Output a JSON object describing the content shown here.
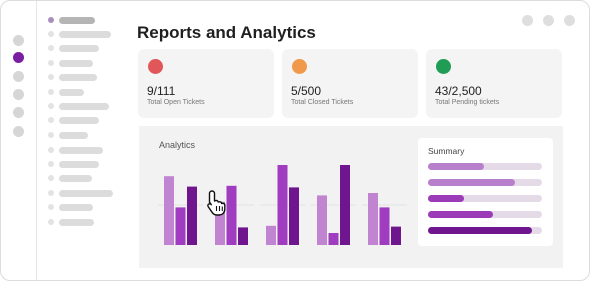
{
  "window": {
    "title": "Reports and Analytics"
  },
  "stats": [
    {
      "value": "9/111",
      "label": "Total Open Tickets",
      "color": "#e15759"
    },
    {
      "value": "5/500",
      "label": "Total Closed Tickets",
      "color": "#f0994a"
    },
    {
      "value": "43/2,500",
      "label": "Total Pending tickets",
      "color": "#1f9d55"
    }
  ],
  "analytics": {
    "title": "Analytics",
    "summary_title": "Summary",
    "summary_levels": [
      0.49,
      0.76,
      0.32,
      0.57,
      0.91
    ]
  },
  "chart_data": {
    "type": "bar",
    "title": "Analytics",
    "xlabel": "",
    "ylabel": "",
    "categories": [
      "",
      "",
      "",
      "",
      ""
    ],
    "ylim": [
      0,
      100
    ],
    "series": [
      {
        "values": [
          86,
          54,
          24,
          62,
          65
        ],
        "color": "#c084d0"
      },
      {
        "values": [
          47,
          74,
          100,
          15,
          47
        ],
        "color": "#a03cc0"
      },
      {
        "values": [
          73,
          22,
          72,
          100,
          23
        ],
        "color": "#6f168f"
      }
    ]
  },
  "colors": {
    "accent": "#7b1fa2",
    "bar_light": "#c084d0",
    "bar_mid": "#a03cc0",
    "bar_dark": "#6f168f"
  },
  "icons": {
    "cursor": "hand-pointer-icon",
    "window_controls": [
      "window-dot-icon",
      "window-dot-icon",
      "window-dot-icon"
    ]
  }
}
